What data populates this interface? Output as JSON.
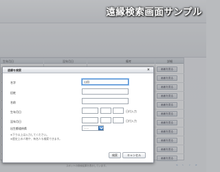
{
  "header": {
    "brand": "",
    "caption": "遠縁検索画面サンプル"
  },
  "results": {
    "columns": [
      "生年月日",
      "没年月日",
      "備考",
      "詳細"
    ],
    "detail_button_label": "画面を見る",
    "footer_note": "スポットの検索結果を表示しています。",
    "pager": {
      "first": "«",
      "prev": "‹",
      "next": "›",
      "last": "»"
    }
  },
  "dialog": {
    "title": "遠縁を検索",
    "close": "×",
    "fields": {
      "surname": {
        "label": "名字",
        "value": "山田"
      },
      "former_name": {
        "label": "旧姓",
        "value": ""
      },
      "given_name": {
        "label": "名前",
        "value": ""
      },
      "birth_date": {
        "label": "生年月日",
        "year": "",
        "month": "",
        "day": "",
        "note": "日付入力"
      },
      "death_date": {
        "label": "没年月日",
        "year": "",
        "month": "",
        "day": "",
        "note": "日付入力"
      },
      "birthplace": {
        "label": "出生都道府県",
        "selected": "——"
      }
    },
    "hints": [
      "※下り以上は入力してください。",
      "※歴史上の人物や、有名人も検索できます。"
    ],
    "buttons": {
      "search": "検索",
      "cancel": "キャンセル"
    }
  },
  "colors": {
    "accent": "#2f6db3",
    "focus_ring": "#4a8ad0",
    "dialog_border": "#8c9099"
  }
}
